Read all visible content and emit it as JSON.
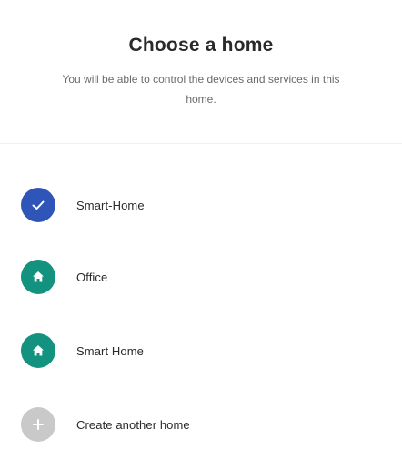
{
  "header": {
    "title": "Choose a home",
    "subtitle": "You will be able to control the devices and services in this home."
  },
  "homes": [
    {
      "label": "Smart-Home",
      "icon": "check-icon",
      "selected": true,
      "color": "#2f55b8"
    },
    {
      "label": "Office",
      "icon": "house-icon",
      "selected": false,
      "color": "#13927f"
    },
    {
      "label": "Smart Home",
      "icon": "house-icon",
      "selected": false,
      "color": "#13927f"
    },
    {
      "label": "Create another home",
      "icon": "plus-icon",
      "selected": false,
      "color": "#c9c9c9"
    }
  ]
}
